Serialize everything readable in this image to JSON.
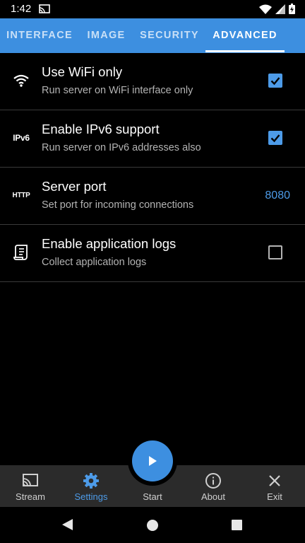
{
  "status_bar": {
    "time": "1:42",
    "icons": [
      "cast-icon",
      "wifi-icon",
      "signal-icon",
      "battery-icon"
    ]
  },
  "tabs": [
    {
      "label": "INTERFACE",
      "active": false
    },
    {
      "label": "IMAGE",
      "active": false
    },
    {
      "label": "SECURITY",
      "active": false
    },
    {
      "label": "ADVANCED",
      "active": true
    }
  ],
  "settings": [
    {
      "icon": "wifi-icon",
      "title": "Use WiFi only",
      "subtitle": "Run server on WiFi interface only",
      "control": "checkbox",
      "checked": true
    },
    {
      "icon": "ipv6-icon",
      "icon_text": "IPv6",
      "title": "Enable IPv6 support",
      "subtitle": "Run server on IPv6 addresses also",
      "control": "checkbox",
      "checked": true
    },
    {
      "icon": "http-icon",
      "icon_text": "HTTP",
      "title": "Server port",
      "subtitle": "Set port for incoming connections",
      "control": "value",
      "value": "8080"
    },
    {
      "icon": "log-icon",
      "title": "Enable application logs",
      "subtitle": "Collect application logs",
      "control": "checkbox",
      "checked": false
    }
  ],
  "bottom_nav": [
    {
      "label": "Stream",
      "icon": "cast-icon",
      "active": false
    },
    {
      "label": "Settings",
      "icon": "gear-icon",
      "active": true
    },
    {
      "label": "Start",
      "icon": "play-icon",
      "active": false
    },
    {
      "label": "About",
      "icon": "info-icon",
      "active": false
    },
    {
      "label": "Exit",
      "icon": "close-icon",
      "active": false
    }
  ],
  "colors": {
    "accent": "#3d8fe0",
    "accent_text": "#4d9be8",
    "background": "#000000",
    "bottom_nav": "#2b2b2b"
  }
}
